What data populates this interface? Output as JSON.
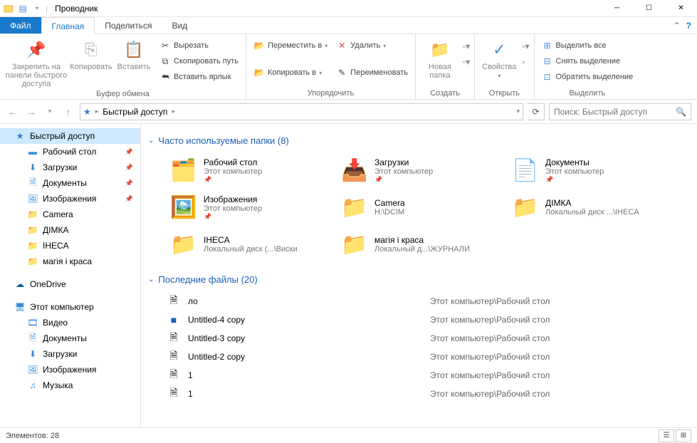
{
  "window": {
    "title": "Проводник"
  },
  "tabs": {
    "file": "Файл",
    "home": "Главная",
    "share": "Поделиться",
    "view": "Вид"
  },
  "ribbon": {
    "clipboard": {
      "pin": "Закрепить на панели быстрого доступа",
      "copy": "Копировать",
      "paste": "Вставить",
      "cut": "Вырезать",
      "copypath": "Скопировать путь",
      "pasteshortcut": "Вставить ярлык",
      "label": "Буфер обмена"
    },
    "organize": {
      "moveto": "Переместить в",
      "copyto": "Копировать в",
      "delete": "Удалить",
      "rename": "Переименовать",
      "label": "Упорядочить"
    },
    "new": {
      "newfolder": "Новая папка",
      "label": "Создать"
    },
    "open": {
      "properties": "Свойства",
      "label": "Открыть"
    },
    "select": {
      "selectall": "Выделить все",
      "selectnone": "Снять выделение",
      "invert": "Обратить выделение",
      "label": "Выделить"
    }
  },
  "address": {
    "root": "Быстрый доступ"
  },
  "search": {
    "placeholder": "Поиск: Быстрый доступ"
  },
  "nav": {
    "quick": "Быстрый доступ",
    "items": [
      {
        "label": "Рабочий стол"
      },
      {
        "label": "Загрузки"
      },
      {
        "label": "Документы"
      },
      {
        "label": "Изображения"
      },
      {
        "label": "Camera"
      },
      {
        "label": "ДІМКА"
      },
      {
        "label": "IHECA"
      },
      {
        "label": "магія і краса"
      }
    ],
    "onedrive": "OneDrive",
    "thispc": "Этот компьютер",
    "pcitems": [
      {
        "label": "Видео"
      },
      {
        "label": "Документы"
      },
      {
        "label": "Загрузки"
      },
      {
        "label": "Изображения"
      },
      {
        "label": "Музыка"
      }
    ]
  },
  "sections": {
    "folders": "Часто используемые папки (8)",
    "recent": "Последние файлы (20)"
  },
  "folders": [
    {
      "name": "Рабочий стол",
      "sub": "Этот компьютер"
    },
    {
      "name": "Загрузки",
      "sub": "Этот компьютер"
    },
    {
      "name": "Документы",
      "sub": "Этот компьютер"
    },
    {
      "name": "Изображения",
      "sub": "Этот компьютер"
    },
    {
      "name": "Camera",
      "sub": "H:\\DCIM"
    },
    {
      "name": "ДІМКА",
      "sub": "Локальный диск ...\\IHECA"
    },
    {
      "name": "IHECA",
      "sub": "Локальный диск (...\\Виски"
    },
    {
      "name": "магія і краса",
      "sub": "Локальный д...\\ЖУРНАЛИ"
    }
  ],
  "files": [
    {
      "name": "ло",
      "path": "Этот компьютер\\Рабочий стол"
    },
    {
      "name": "Untitled-4 copy",
      "path": "Этот компьютер\\Рабочий стол"
    },
    {
      "name": "Untitled-3 copy",
      "path": "Этот компьютер\\Рабочий стол"
    },
    {
      "name": "Untitled-2 copy",
      "path": "Этот компьютер\\Рабочий стол"
    },
    {
      "name": "1",
      "path": "Этот компьютер\\Рабочий стол"
    },
    {
      "name": "1",
      "path": "Этот компьютер\\Рабочий стол"
    }
  ],
  "status": {
    "count": "Элементов: 28"
  }
}
